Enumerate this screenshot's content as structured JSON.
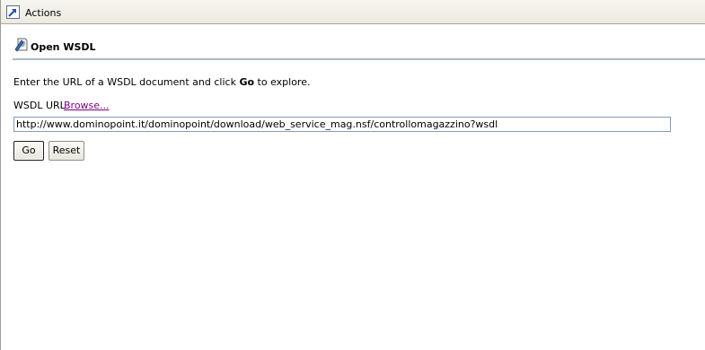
{
  "titlebar": {
    "title": "Actions",
    "icon": "arrow-action-icon"
  },
  "section": {
    "title": "Open WSDL",
    "icon": "wsdl-document-icon"
  },
  "instructions": {
    "before": "Enter the URL of a WSDL document and click ",
    "bold": "Go",
    "after": " to explore."
  },
  "form": {
    "url_label": "WSDL URL",
    "browse_label": "Browse...",
    "url_value": "http://www.dominopoint.it/dominopoint/download/web_service_mag.nsf/controllomagazzino?wsdl",
    "go_label": "Go",
    "reset_label": "Reset"
  },
  "colors": {
    "link_visited": "#800080",
    "section_rule": "#aeb9c8",
    "input_border": "#7f9db9"
  }
}
